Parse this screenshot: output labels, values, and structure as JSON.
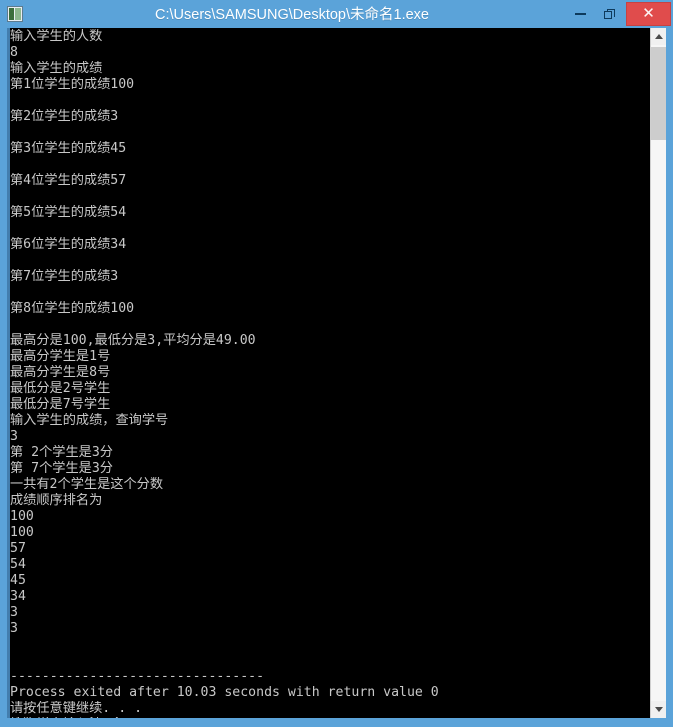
{
  "window": {
    "title": "C:\\Users\\SAMSUNG\\Desktop\\未命名1.exe",
    "icon": "console-app-icon",
    "accent_color": "#5ba3d9",
    "close_button_color": "#e04c4c",
    "controls": {
      "minimize_label": "–",
      "restore_label": "❐",
      "close_label": "✕"
    }
  },
  "console": {
    "background_color": "#000000",
    "text_color": "#c8c8c8",
    "lines": [
      "输入学生的人数",
      "8",
      "输入学生的成绩",
      "第1位学生的成绩100",
      "",
      "第2位学生的成绩3",
      "",
      "第3位学生的成绩45",
      "",
      "第4位学生的成绩57",
      "",
      "第5位学生的成绩54",
      "",
      "第6位学生的成绩34",
      "",
      "第7位学生的成绩3",
      "",
      "第8位学生的成绩100",
      "",
      "最高分是100,最低分是3,平均分是49.00",
      "最高分学生是1号",
      "最高分学生是8号",
      "最低分是2号学生",
      "最低分是7号学生",
      "输入学生的成绩，查询学号",
      "3",
      "第 2个学生是3分",
      "第 7个学生是3分",
      "一共有2个学生是这个分数",
      "成绩顺序排名为",
      "100",
      "100",
      "57",
      "54",
      "45",
      "34",
      "3",
      "3",
      "",
      "",
      "--------------------------------",
      "Process exited after 10.03 seconds with return value 0",
      "请按任意键继续. . .",
      "搜狗拼音输入法 全 ："
    ]
  },
  "scrollbar": {
    "up_arrow": "scroll-up-arrow",
    "down_arrow": "scroll-down-arrow",
    "thumb": "scroll-thumb",
    "track_color": "#f6f6f6",
    "thumb_color": "#cdcdcd"
  }
}
